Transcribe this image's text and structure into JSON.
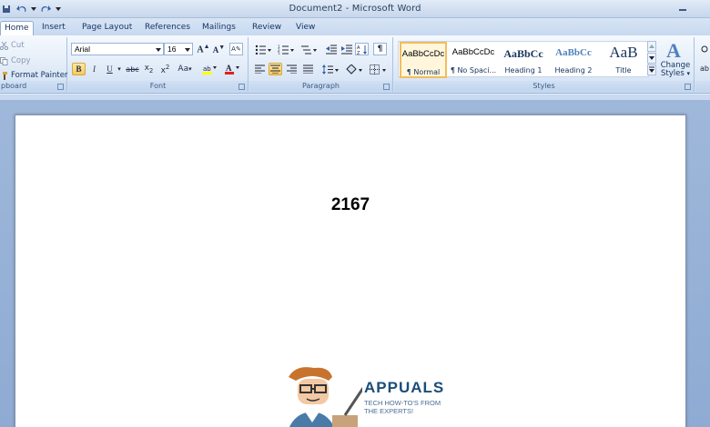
{
  "window": {
    "title": "Document2 - Microsoft Word"
  },
  "tabs": [
    "Home",
    "Insert",
    "Page Layout",
    "References",
    "Mailings",
    "Review",
    "View"
  ],
  "clipboard": {
    "cut": "Cut",
    "copy": "Copy",
    "format_painter": "Format Painter",
    "label": "pboard"
  },
  "font": {
    "name": "Arial",
    "size": "16",
    "label": "Font"
  },
  "paragraph": {
    "label": "Paragraph"
  },
  "styles": {
    "label": "Styles",
    "items": [
      {
        "sample": "AaBbCcDc",
        "name": "¶ Normal"
      },
      {
        "sample": "AaBbCcDc",
        "name": "¶ No Spaci..."
      },
      {
        "sample": "AaBbCc",
        "name": "Heading 1"
      },
      {
        "sample": "AaBbCc",
        "name": "Heading 2"
      },
      {
        "sample": "AaB",
        "name": "Title"
      }
    ],
    "change_styles_line1": "Change",
    "change_styles_line2": "Styles"
  },
  "document": {
    "text": "2167"
  },
  "watermark": {
    "brand": "APPUALS",
    "tagline_1": "TECH HOW-TO'S FROM",
    "tagline_2": "THE EXPERTS!"
  },
  "colors": {
    "accent": "#3b5a86",
    "selected": "#f7c95b",
    "page": "#ffffff"
  }
}
